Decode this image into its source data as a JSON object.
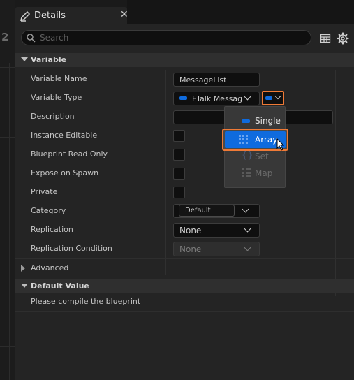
{
  "window": {
    "number_label": "2"
  },
  "tab": {
    "title": "Details",
    "close": "✕",
    "icon": "pencil-icon"
  },
  "search": {
    "placeholder": "Search",
    "value": ""
  },
  "toolbar": {
    "table_icon": "table-view-icon",
    "settings_icon": "gear-icon"
  },
  "sections": {
    "variable": {
      "label": "Variable"
    },
    "advanced": {
      "label": "Advanced"
    },
    "default_value": {
      "label": "Default Value",
      "message": "Please compile the blueprint"
    }
  },
  "properties": {
    "variable_name": {
      "label": "Variable Name",
      "value": "MessageList"
    },
    "variable_type": {
      "label": "Variable Type",
      "value": "FTalk Message",
      "type_color": "#0f6bde"
    },
    "description": {
      "label": "Description",
      "value": ""
    },
    "instance_editable": {
      "label": "Instance Editable",
      "checked": false
    },
    "blueprint_read_only": {
      "label": "Blueprint Read Only",
      "checked": false
    },
    "expose_on_spawn": {
      "label": "Expose on Spawn",
      "checked": false
    },
    "private": {
      "label": "Private",
      "checked": false
    },
    "category": {
      "label": "Category",
      "value": "Default"
    },
    "replication": {
      "label": "Replication",
      "value": "None"
    },
    "replication_condition": {
      "label": "Replication Condition",
      "value": "None"
    }
  },
  "container_menu": {
    "items": [
      {
        "label": "Single",
        "icon": "single-icon",
        "enabled": true,
        "selected": false
      },
      {
        "label": "Array",
        "icon": "array-icon",
        "enabled": true,
        "selected": true
      },
      {
        "label": "Set",
        "icon": "set-icon",
        "enabled": false,
        "selected": false
      },
      {
        "label": "Map",
        "icon": "map-icon",
        "enabled": false,
        "selected": false
      }
    ]
  },
  "colors": {
    "accent": "#0f6bde",
    "highlight": "#f07a36",
    "panel_bg": "#242424",
    "field_bg": "#0f0f0f"
  }
}
